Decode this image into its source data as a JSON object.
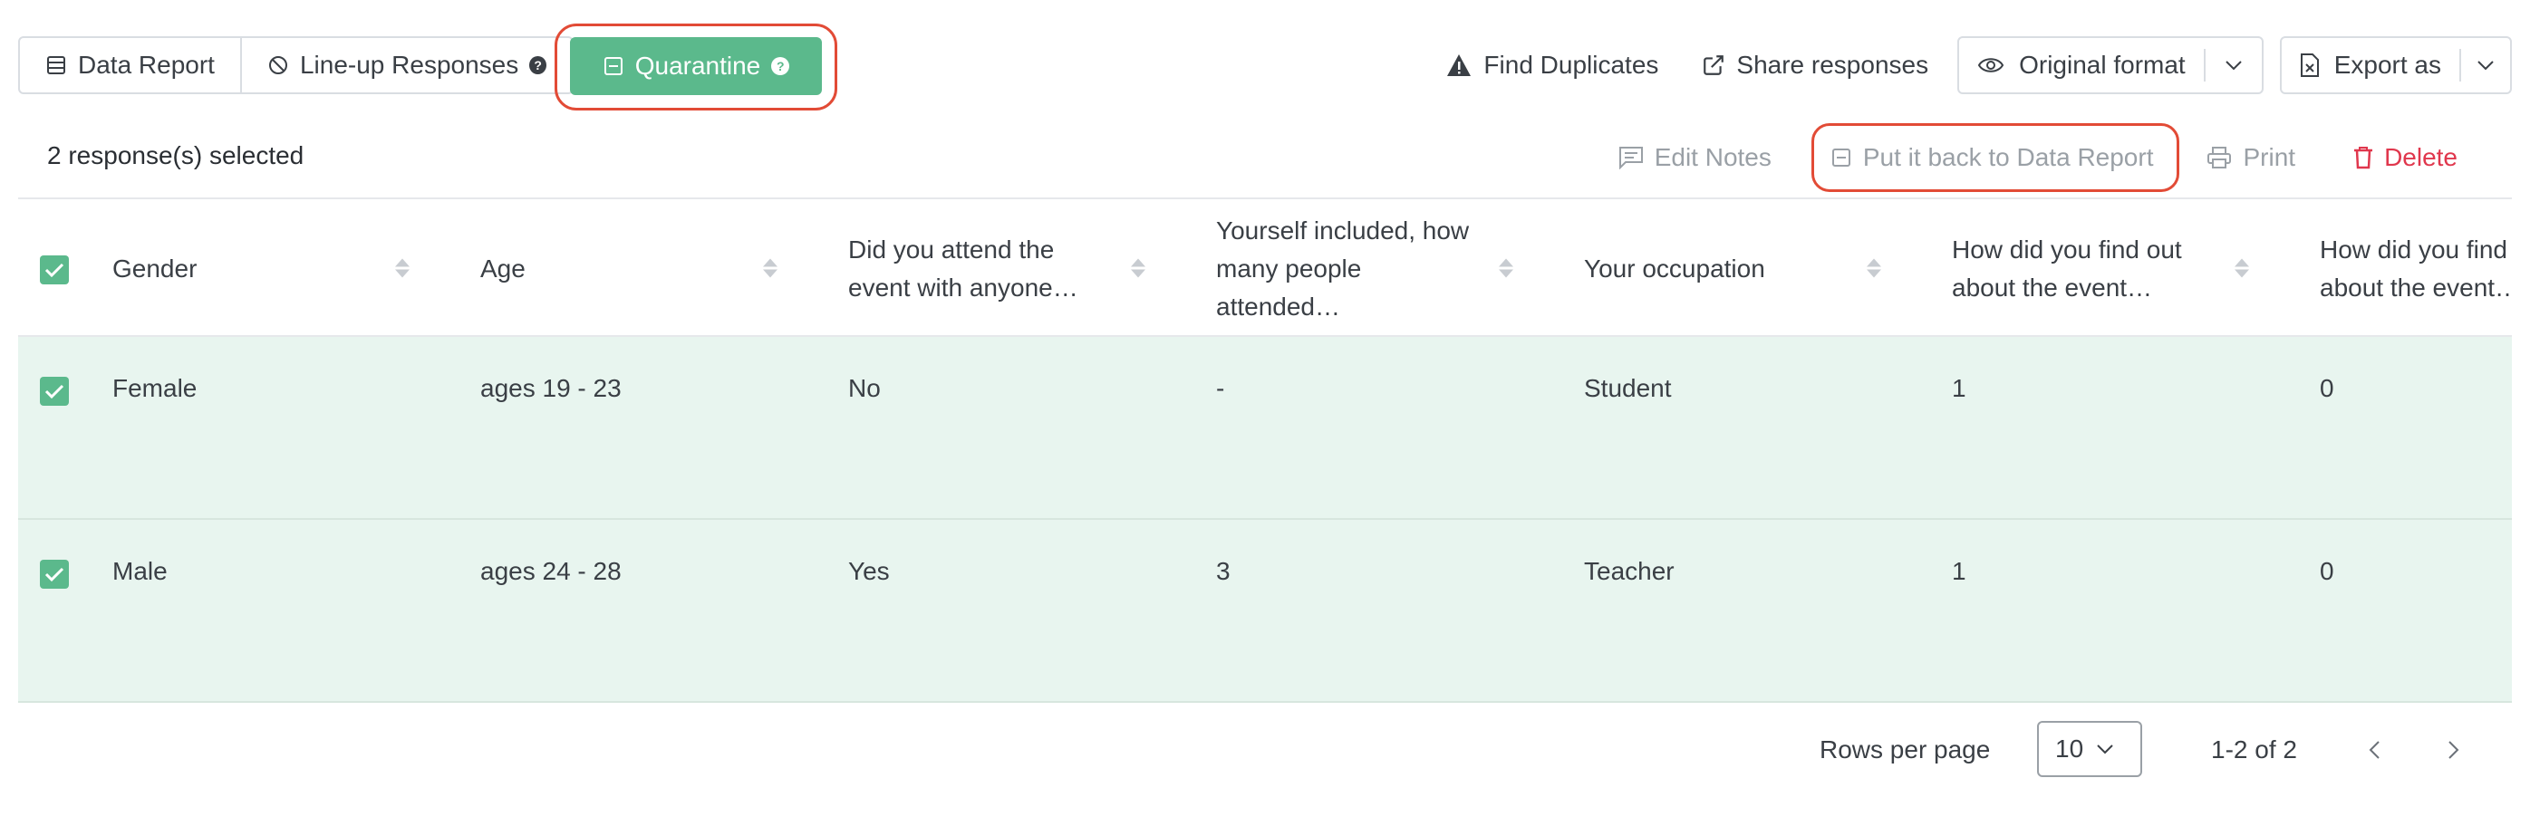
{
  "toolbar": {
    "tabs": [
      {
        "label": "Data Report",
        "icon": "table-icon"
      },
      {
        "label": "Line-up Responses",
        "icon": "block-icon",
        "help": "?"
      }
    ],
    "quarantine": {
      "label": "Quarantine",
      "icon": "minus-square-icon",
      "help": "?"
    },
    "find_duplicates": "Find Duplicates",
    "share_responses": "Share responses",
    "format_select": "Original format",
    "export_as": "Export as"
  },
  "selection": {
    "count_text": "2 response(s) selected",
    "edit_notes": "Edit Notes",
    "put_back": "Put it back to Data Report",
    "print": "Print",
    "delete": "Delete"
  },
  "table": {
    "columns": [
      "Gender",
      "Age",
      "Did you attend the event with anyone…",
      "Yourself included, how many people attended…",
      "Your occupation",
      "How did you find out about the event…",
      "How did you find out about the event…"
    ],
    "rows": [
      [
        "Female",
        "ages 19 - 23",
        "No",
        "-",
        "Student",
        "1",
        "0"
      ],
      [
        "Male",
        "ages 24 - 28",
        "Yes",
        "3",
        "Teacher",
        "1",
        "0"
      ]
    ]
  },
  "pagination": {
    "rows_per_page_label": "Rows per page",
    "rows_per_page_value": "10",
    "range_text": "1-2 of 2"
  },
  "colors": {
    "accent_green": "#5bb98c",
    "row_selected_bg": "#e8f5ef",
    "highlight_red": "#e24b36",
    "delete_red": "#e0374d"
  }
}
